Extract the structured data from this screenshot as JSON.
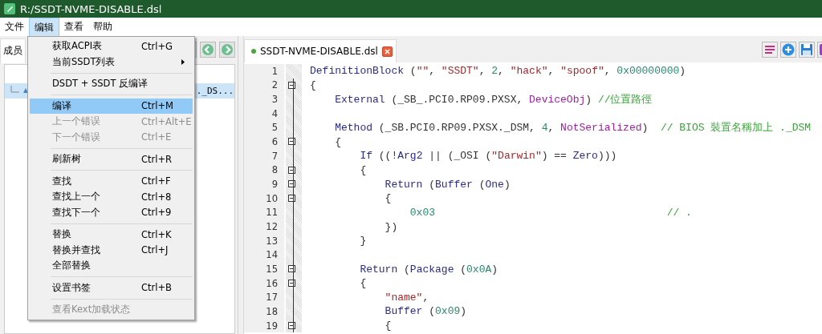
{
  "window": {
    "title": "R:/SSDT-NVME-DISABLE.dsl"
  },
  "menubar": [
    {
      "label": "文件",
      "selected": false
    },
    {
      "label": "编辑",
      "selected": true
    },
    {
      "label": "查看",
      "selected": false
    },
    {
      "label": "帮助",
      "selected": false
    }
  ],
  "menu": [
    {
      "kind": "item",
      "label": "获取ACPI表",
      "shortcut": "Ctrl+G",
      "disabled": false,
      "selected": false,
      "submenu": false
    },
    {
      "kind": "item",
      "label": "当前SSDT列表",
      "disabled": false,
      "selected": false,
      "submenu": true
    },
    {
      "kind": "separator"
    },
    {
      "kind": "item",
      "label": "DSDT + SSDT 反编译",
      "disabled": false,
      "selected": false,
      "submenu": false
    },
    {
      "kind": "separator"
    },
    {
      "kind": "item",
      "label": "编译",
      "shortcut": "Ctrl+M",
      "disabled": false,
      "selected": true,
      "submenu": false
    },
    {
      "kind": "item",
      "label": "上一个错误",
      "shortcut": "Ctrl+Alt+E",
      "disabled": true,
      "selected": false,
      "submenu": false
    },
    {
      "kind": "item",
      "label": "下一个错误",
      "shortcut": "Ctrl+E",
      "disabled": true,
      "selected": false,
      "submenu": false
    },
    {
      "kind": "separator"
    },
    {
      "kind": "item",
      "label": "刷新树",
      "shortcut": "Ctrl+R",
      "disabled": false,
      "selected": false,
      "submenu": false
    },
    {
      "kind": "separator"
    },
    {
      "kind": "item",
      "label": "查找",
      "shortcut": "Ctrl+F",
      "disabled": false,
      "selected": false,
      "submenu": false
    },
    {
      "kind": "item",
      "label": "查找上一个",
      "shortcut": "Ctrl+8",
      "disabled": false,
      "selected": false,
      "submenu": false
    },
    {
      "kind": "item",
      "label": "查找下一个",
      "shortcut": "Ctrl+9",
      "disabled": false,
      "selected": false,
      "submenu": false
    },
    {
      "kind": "separator"
    },
    {
      "kind": "item",
      "label": "替换",
      "shortcut": "Ctrl+K",
      "disabled": false,
      "selected": false,
      "submenu": false
    },
    {
      "kind": "item",
      "label": "替换并查找",
      "shortcut": "Ctrl+J",
      "disabled": false,
      "selected": false,
      "submenu": false
    },
    {
      "kind": "item",
      "label": "全部替换",
      "disabled": false,
      "selected": false,
      "submenu": false
    },
    {
      "kind": "separator"
    },
    {
      "kind": "item",
      "label": "设置书签",
      "shortcut": "Ctrl+B",
      "disabled": false,
      "selected": false,
      "submenu": false
    },
    {
      "kind": "separator"
    },
    {
      "kind": "item",
      "label": "查看Kext加载状态",
      "disabled": true,
      "selected": false,
      "submenu": false
    }
  ],
  "left_panel": {
    "tab": "成员",
    "tree": [
      {
        "label": "._DS...",
        "selected": true
      }
    ]
  },
  "editor": {
    "tab": {
      "label": "SSDT-NVME-DISABLE.dsl",
      "modified": true
    },
    "lines": [
      {
        "number": "1",
        "tokens": [
          {
            "kind": "kw",
            "text": "DefinitionBlock"
          },
          {
            "kind": "plain",
            "text": " ("
          },
          {
            "kind": "str",
            "text": "\"\""
          },
          {
            "kind": "plain",
            "text": ", "
          },
          {
            "kind": "str",
            "text": "\"SSDT\""
          },
          {
            "kind": "plain",
            "text": ", "
          },
          {
            "kind": "num",
            "text": "2"
          },
          {
            "kind": "plain",
            "text": ", "
          },
          {
            "kind": "str",
            "text": "\"hack\""
          },
          {
            "kind": "plain",
            "text": ", "
          },
          {
            "kind": "str",
            "text": "\"spoof\""
          },
          {
            "kind": "plain",
            "text": ", "
          },
          {
            "kind": "num",
            "text": "0x00000000"
          },
          {
            "kind": "plain",
            "text": ")"
          }
        ]
      },
      {
        "number": "2",
        "expanded": true,
        "tokens": [
          {
            "kind": "plain",
            "text": "{"
          }
        ]
      },
      {
        "number": "3",
        "tokens": [
          {
            "kind": "kw",
            "text": "    External"
          },
          {
            "kind": "plain",
            "text": " (_SB_.PCI0.RP09.PXSX, "
          },
          {
            "kind": "type",
            "text": "DeviceObj"
          },
          {
            "kind": "plain",
            "text": ") "
          },
          {
            "kind": "cmt",
            "text": "//位置路徑"
          }
        ]
      },
      {
        "number": "4"
      },
      {
        "number": "5",
        "tokens": [
          {
            "kind": "kw",
            "text": "    Method"
          },
          {
            "kind": "plain",
            "text": " (_SB.PCI0.RP09.PXSX._DSM, "
          },
          {
            "kind": "num",
            "text": "4"
          },
          {
            "kind": "plain",
            "text": ", "
          },
          {
            "kind": "type",
            "text": "NotSerialized"
          },
          {
            "kind": "plain",
            "text": ")  "
          },
          {
            "kind": "cmt",
            "text": "// BIOS 裝置名稱加上 ._DSM"
          }
        ]
      },
      {
        "number": "6",
        "expanded": true,
        "tokens": [
          {
            "kind": "plain",
            "text": "    {"
          }
        ]
      },
      {
        "number": "7",
        "tokens": [
          {
            "kind": "kw",
            "text": "        If"
          },
          {
            "kind": "plain",
            "text": " ((!"
          },
          {
            "kind": "kw",
            "text": "Arg2"
          },
          {
            "kind": "plain",
            "text": " || (_OSI ("
          },
          {
            "kind": "str",
            "text": "\"Darwin\""
          },
          {
            "kind": "plain",
            "text": ") == "
          },
          {
            "kind": "kw",
            "text": "Zero"
          },
          {
            "kind": "plain",
            "text": ")))"
          }
        ]
      },
      {
        "number": "8",
        "expanded": true,
        "tokens": [
          {
            "kind": "plain",
            "text": "        {"
          }
        ]
      },
      {
        "number": "9",
        "expanded": true,
        "tokens": [
          {
            "kind": "kw",
            "text": "            Return"
          },
          {
            "kind": "plain",
            "text": " ("
          },
          {
            "kind": "kw",
            "text": "Buffer"
          },
          {
            "kind": "plain",
            "text": " ("
          },
          {
            "kind": "kw",
            "text": "One"
          },
          {
            "kind": "plain",
            "text": ")"
          }
        ]
      },
      {
        "number": "10",
        "expanded": true,
        "tokens": [
          {
            "kind": "plain",
            "text": "            {"
          }
        ]
      },
      {
        "number": "11",
        "tokens": [
          {
            "kind": "num",
            "text": "                0x03"
          },
          {
            "kind": "cmt",
            "text": "                                     // ."
          }
        ]
      },
      {
        "number": "12",
        "tokens": [
          {
            "kind": "plain",
            "text": "            })"
          }
        ]
      },
      {
        "number": "13",
        "tokens": [
          {
            "kind": "plain",
            "text": "        }"
          }
        ]
      },
      {
        "number": "14"
      },
      {
        "number": "15",
        "expanded": true,
        "tokens": [
          {
            "kind": "kw",
            "text": "        Return"
          },
          {
            "kind": "plain",
            "text": " ("
          },
          {
            "kind": "kw",
            "text": "Package"
          },
          {
            "kind": "plain",
            "text": " ("
          },
          {
            "kind": "num",
            "text": "0x0A"
          },
          {
            "kind": "plain",
            "text": ")"
          }
        ]
      },
      {
        "number": "16",
        "expanded": true,
        "tokens": [
          {
            "kind": "plain",
            "text": "        {"
          }
        ]
      },
      {
        "number": "17",
        "tokens": [
          {
            "kind": "str",
            "text": "            \"name\""
          },
          {
            "kind": "plain",
            "text": ","
          }
        ]
      },
      {
        "number": "18",
        "tokens": [
          {
            "kind": "kw",
            "text": "            Buffer"
          },
          {
            "kind": "plain",
            "text": " ("
          },
          {
            "kind": "num",
            "text": "0x09"
          },
          {
            "kind": "plain",
            "text": ")"
          }
        ]
      },
      {
        "number": "19",
        "expanded": true,
        "tokens": [
          {
            "kind": "plain",
            "text": "            {"
          }
        ]
      }
    ]
  }
}
